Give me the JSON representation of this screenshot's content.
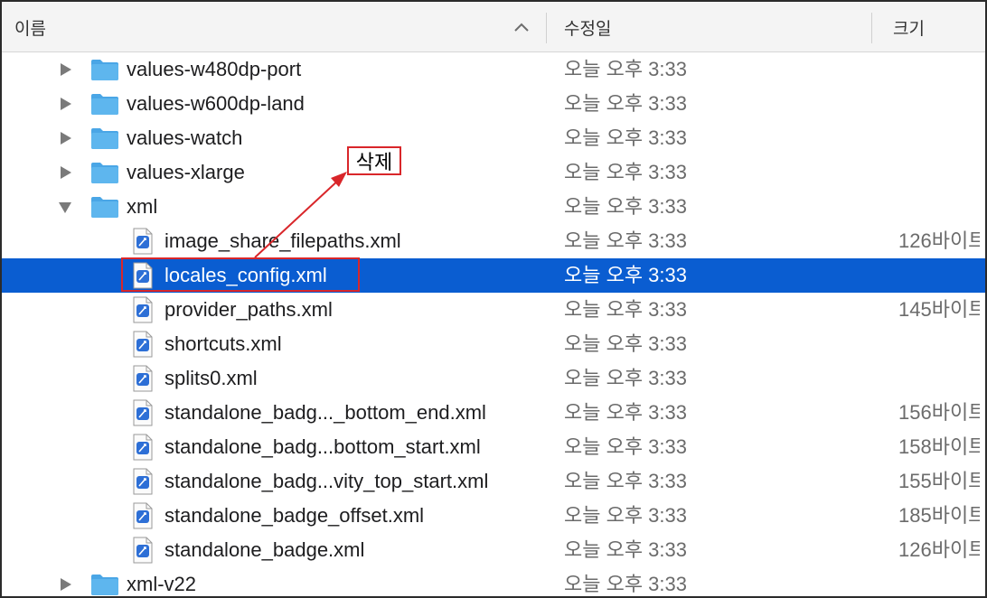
{
  "header": {
    "col_name": "이름",
    "col_date": "수정일",
    "col_size": "크기"
  },
  "rows": [
    {
      "name": "values-w480dp-port",
      "type": "folder",
      "disclosure": "collapsed",
      "date": "오늘 오후 3:33",
      "size": ""
    },
    {
      "name": "values-w600dp-land",
      "type": "folder",
      "disclosure": "collapsed",
      "date": "오늘 오후 3:33",
      "size": ""
    },
    {
      "name": "values-watch",
      "type": "folder",
      "disclosure": "collapsed",
      "date": "오늘 오후 3:33",
      "size": ""
    },
    {
      "name": "values-xlarge",
      "type": "folder",
      "disclosure": "collapsed",
      "date": "오늘 오후 3:33",
      "size": ""
    },
    {
      "name": "xml",
      "type": "folder",
      "disclosure": "expanded",
      "date": "오늘 오후 3:33",
      "size": ""
    },
    {
      "name": "image_share_filepaths.xml",
      "type": "file",
      "date": "오늘 오후 3:33",
      "size": "126바이트"
    },
    {
      "name": "locales_config.xml",
      "type": "file",
      "date": "오늘 오후 3:33",
      "size": "",
      "selected": true
    },
    {
      "name": "provider_paths.xml",
      "type": "file",
      "date": "오늘 오후 3:33",
      "size": "145바이트"
    },
    {
      "name": "shortcuts.xml",
      "type": "file",
      "date": "오늘 오후 3:33",
      "size": ""
    },
    {
      "name": "splits0.xml",
      "type": "file",
      "date": "오늘 오후 3:33",
      "size": ""
    },
    {
      "name": "standalone_badg..._bottom_end.xml",
      "type": "file",
      "date": "오늘 오후 3:33",
      "size": "156바이트"
    },
    {
      "name": "standalone_badg...bottom_start.xml",
      "type": "file",
      "date": "오늘 오후 3:33",
      "size": "158바이트"
    },
    {
      "name": "standalone_badg...vity_top_start.xml",
      "type": "file",
      "date": "오늘 오후 3:33",
      "size": "155바이트"
    },
    {
      "name": "standalone_badge_offset.xml",
      "type": "file",
      "date": "오늘 오후 3:33",
      "size": "185바이트"
    },
    {
      "name": "standalone_badge.xml",
      "type": "file",
      "date": "오늘 오후 3:33",
      "size": "126바이트"
    },
    {
      "name": "xml-v22",
      "type": "folder",
      "disclosure": "collapsed",
      "date": "오늘 오후 3:33",
      "size": ""
    }
  ],
  "annotation": {
    "label": "삭제",
    "color": "#d9262a"
  },
  "colors": {
    "selection": "#0a5dd1",
    "folder": "#5eb6ee"
  }
}
